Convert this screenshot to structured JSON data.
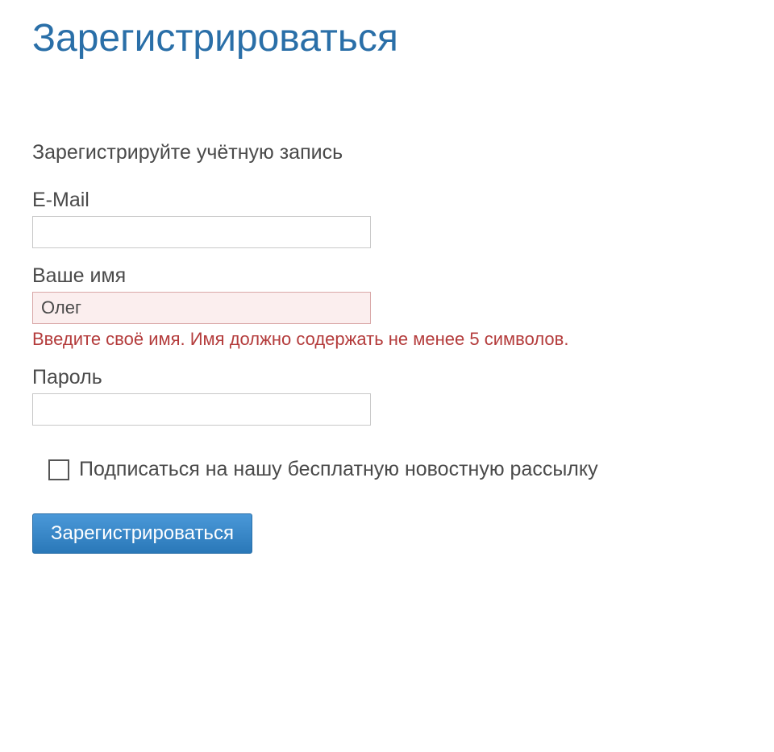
{
  "title": "Зарегистрироваться",
  "subtitle": "Зарегистрируйте учётную запись",
  "form": {
    "email": {
      "label": "E-Mail",
      "value": ""
    },
    "name": {
      "label": "Ваше имя",
      "value": "Олег",
      "error": "Введите своё имя. Имя должно содержать не менее 5 символов."
    },
    "password": {
      "label": "Пароль",
      "value": ""
    },
    "newsletter": {
      "checked": false,
      "label": "Подписаться на нашу бесплатную новостную рассылку"
    },
    "submit_label": "Зарегистрироваться"
  }
}
